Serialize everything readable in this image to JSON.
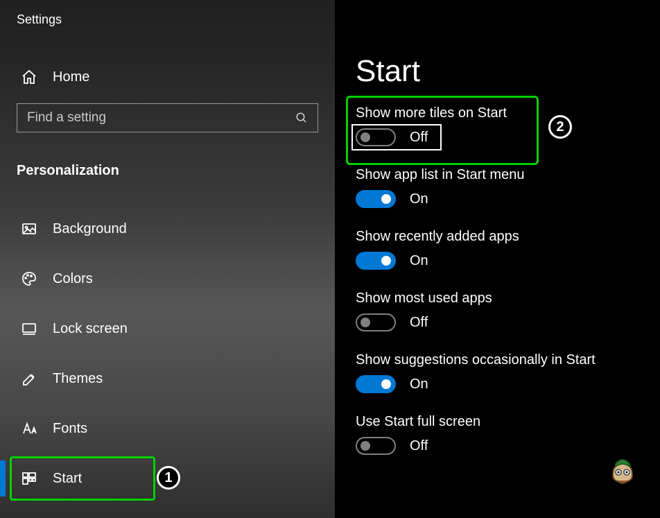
{
  "appTitle": "Settings",
  "home": {
    "label": "Home"
  },
  "search": {
    "placeholder": "Find a setting"
  },
  "groupLabel": "Personalization",
  "nav": {
    "items": [
      {
        "label": "Background"
      },
      {
        "label": "Colors"
      },
      {
        "label": "Lock screen"
      },
      {
        "label": "Themes"
      },
      {
        "label": "Fonts"
      },
      {
        "label": "Start"
      }
    ]
  },
  "page": {
    "title": "Start",
    "settings": [
      {
        "label": "Show more tiles on Start",
        "state": "Off",
        "on": false
      },
      {
        "label": "Show app list in Start menu",
        "state": "On",
        "on": true
      },
      {
        "label": "Show recently added apps",
        "state": "On",
        "on": true
      },
      {
        "label": "Show most used apps",
        "state": "Off",
        "on": false
      },
      {
        "label": "Show suggestions occasionally in Start",
        "state": "On",
        "on": true
      },
      {
        "label": "Use Start full screen",
        "state": "Off",
        "on": false
      }
    ]
  },
  "annotations": {
    "step1": "1",
    "step2": "2"
  }
}
